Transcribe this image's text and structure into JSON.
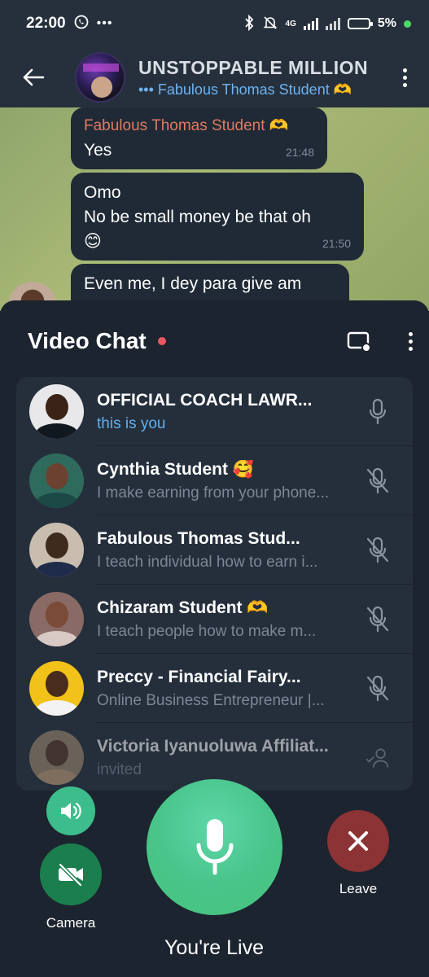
{
  "status_bar": {
    "time": "22:00",
    "network": "4G",
    "battery": "5%"
  },
  "header": {
    "title": "UNSTOPPABLE MILLION",
    "subtitle": "••• Fabulous Thomas Student 🫶"
  },
  "messages": [
    {
      "sender": "Fabulous Thomas Student 🫶",
      "text": "Yes",
      "time": "21:48"
    },
    {
      "text_line1": "Omo",
      "text_line2": "No be small money be that oh",
      "emoji": "😊",
      "time": "21:50"
    },
    {
      "text": "Even me, I dey para give am"
    }
  ],
  "video_chat": {
    "title": "Video Chat",
    "participants": [
      {
        "name": "OFFICIAL COACH LAWR...",
        "status": "this is you",
        "mic": "mic-on",
        "avatar_bg": "#e8e8ea",
        "face": "#3a2418",
        "body": "#111820"
      },
      {
        "name": "Cynthia Student 🥰",
        "status": "I make earning from your phone...",
        "mic": "mic-muted",
        "avatar_bg": "#2f6b5c",
        "face": "#6b4230",
        "body": "#1b4a46"
      },
      {
        "name": "Fabulous Thomas Stud...",
        "status": "I teach individual how to earn i...",
        "mic": "mic-muted",
        "avatar_bg": "#c9bdb0",
        "face": "#3f2a1e",
        "body": "#1e2b4a"
      },
      {
        "name": "Chizaram Student 🫶",
        "status": "I teach people how to make m...",
        "mic": "mic-muted",
        "avatar_bg": "#8a6a64",
        "face": "#7a4c38",
        "body": "#d8c9c4"
      },
      {
        "name": "Preccy - Financial Fairy...",
        "status": "Online Business Entrepreneur |...",
        "mic": "mic-muted",
        "avatar_bg": "#f2c21a",
        "face": "#4a2c1c",
        "body": "#f3f3f3"
      },
      {
        "name": "Victoria Iyanuoluwa Affiliat...",
        "status": "invited",
        "mic": "invited",
        "avatar_bg": "#a58d72",
        "face": "#5a3a28",
        "body": "#caa27a"
      }
    ]
  },
  "controls": {
    "camera_label": "Camera",
    "live_label": "You're Live",
    "leave_label": "Leave"
  },
  "colors": {
    "speaker": "#3dbd8b",
    "camera": "#1b7e4d",
    "mic": "#49c58c",
    "leave": "#8b3335",
    "accent_blue": "#5fb0f0"
  }
}
